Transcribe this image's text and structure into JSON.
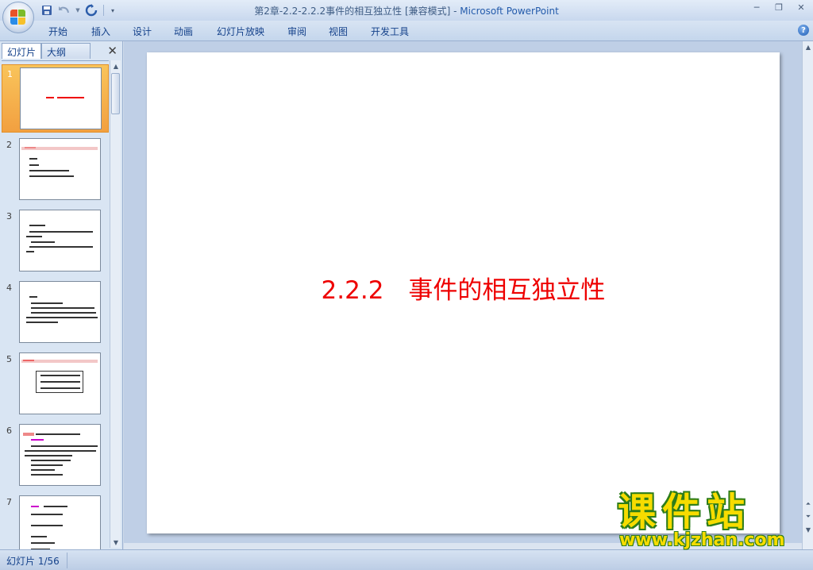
{
  "window": {
    "title_doc": "第2章-2.2-2.2.2事件的相互独立性 [兼容模式] - ",
    "title_app": "Microsoft PowerPoint",
    "minimize": "─",
    "restore": "❐",
    "close": "✕"
  },
  "ribbon": {
    "tabs": [
      "开始",
      "插入",
      "设计",
      "动画",
      "幻灯片放映",
      "审阅",
      "视图",
      "开发工具"
    ],
    "help": "?"
  },
  "panel": {
    "tab_slides": "幻灯片",
    "tab_outline": "大纲",
    "close": "✕",
    "slide_numbers": [
      "1",
      "2",
      "3",
      "4",
      "5",
      "6",
      "7"
    ]
  },
  "slide": {
    "title": "2.2.2　事件的相互独立性"
  },
  "status": {
    "slide_indicator": "幻灯片 1/56"
  },
  "watermark": {
    "brand": "课件站",
    "url": "www.kjzhan.com"
  },
  "colors": {
    "accent_red": "#ee0000",
    "selection_orange": "#f2a040",
    "ribbon_blue": "#15428b",
    "watermark_yellow": "#f7dc00",
    "watermark_green": "#2e7d1a"
  }
}
